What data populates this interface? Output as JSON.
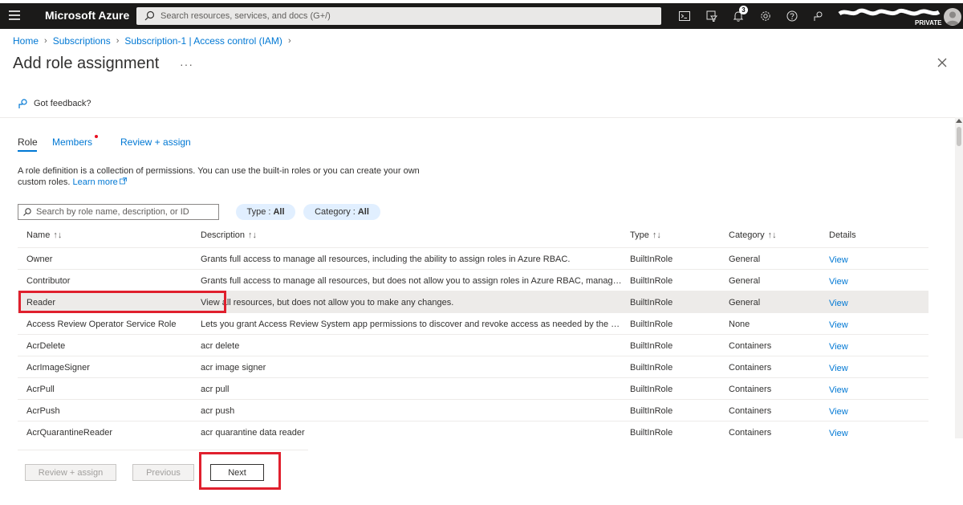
{
  "topbar": {
    "brand": "Microsoft Azure",
    "search_placeholder": "Search resources, services, and docs (G+/)",
    "notification_count": "3",
    "account_label": "PRIVATE"
  },
  "breadcrumb": [
    "Home",
    "Subscriptions",
    "Subscription-1 | Access control (IAM)"
  ],
  "page": {
    "title": "Add role assignment",
    "more": "···",
    "feedback": "Got feedback?"
  },
  "tabs": [
    {
      "label": "Role",
      "active": true
    },
    {
      "label": "Members",
      "active": false
    },
    {
      "label": "Review + assign",
      "active": false
    }
  ],
  "description": {
    "text": "A role definition is a collection of permissions. You can use the built-in roles or you can create your own custom roles.",
    "link": "Learn more"
  },
  "filters": {
    "search_placeholder": "Search by role name, description, or ID",
    "type_label": "Type :",
    "type_value": "All",
    "category_label": "Category :",
    "category_value": "All"
  },
  "table": {
    "headers": {
      "name": "Name",
      "description": "Description",
      "type": "Type",
      "category": "Category",
      "details": "Details"
    },
    "sort_glyph": "↑↓",
    "rows": [
      {
        "name": "Owner",
        "description": "Grants full access to manage all resources, including the ability to assign roles in Azure RBAC.",
        "type": "BuiltInRole",
        "category": "General",
        "details": "View"
      },
      {
        "name": "Contributor",
        "description": "Grants full access to manage all resources, but does not allow you to assign roles in Azure RBAC, manage as...",
        "type": "BuiltInRole",
        "category": "General",
        "details": "View"
      },
      {
        "name": "Reader",
        "description": "View all resources, but does not allow you to make any changes.",
        "type": "BuiltInRole",
        "category": "General",
        "details": "View"
      },
      {
        "name": "Access Review Operator Service Role",
        "description": "Lets you grant Access Review System app permissions to discover and revoke access as needed by the acces...",
        "type": "BuiltInRole",
        "category": "None",
        "details": "View"
      },
      {
        "name": "AcrDelete",
        "description": "acr delete",
        "type": "BuiltInRole",
        "category": "Containers",
        "details": "View"
      },
      {
        "name": "AcrImageSigner",
        "description": "acr image signer",
        "type": "BuiltInRole",
        "category": "Containers",
        "details": "View"
      },
      {
        "name": "AcrPull",
        "description": "acr pull",
        "type": "BuiltInRole",
        "category": "Containers",
        "details": "View"
      },
      {
        "name": "AcrPush",
        "description": "acr push",
        "type": "BuiltInRole",
        "category": "Containers",
        "details": "View"
      },
      {
        "name": "AcrQuarantineReader",
        "description": "acr quarantine data reader",
        "type": "BuiltInRole",
        "category": "Containers",
        "details": "View"
      }
    ]
  },
  "footer": {
    "review_assign": "Review + assign",
    "previous": "Previous",
    "next": "Next"
  },
  "colors": {
    "accent": "#0078d4",
    "highlight": "#e0202e",
    "topbar": "#1b1a19"
  }
}
